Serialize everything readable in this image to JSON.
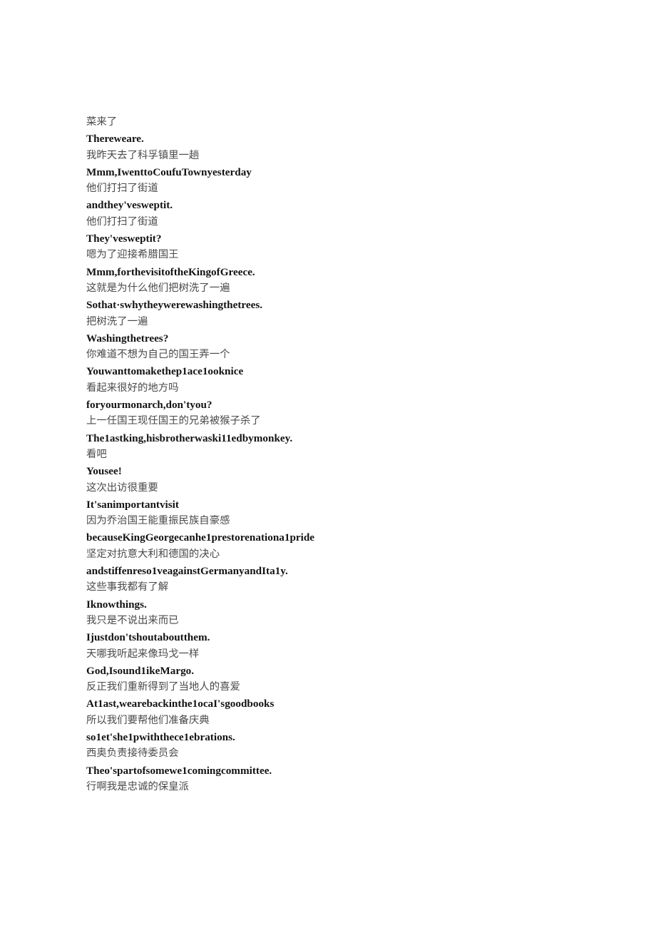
{
  "document": {
    "background_color": "#ffffff",
    "zh_text_color": "#4a4a4a",
    "en_text_color": "#131313",
    "lines": [
      {
        "lang": "zh",
        "text": "菜来了"
      },
      {
        "lang": "en",
        "text": "Thereweare."
      },
      {
        "lang": "zh",
        "text": "我昨天去了科孚镇里一趟"
      },
      {
        "lang": "en",
        "text": "Mmm,IwenttoCoufuTownyesterday"
      },
      {
        "lang": "zh",
        "text": "他们打扫了街道"
      },
      {
        "lang": "en",
        "text": "andthey'vesweptit."
      },
      {
        "lang": "zh",
        "text": "他们打扫了街道"
      },
      {
        "lang": "en",
        "text": "They'vesweptit?"
      },
      {
        "lang": "zh",
        "text": "嗯为了迎接希腊国王"
      },
      {
        "lang": "en",
        "text": "Mmm,forthevisitoftheKingofGreece."
      },
      {
        "lang": "zh",
        "text": "这就是为什么他们把树洗了一遍"
      },
      {
        "lang": "en",
        "text": "Sothat·swhytheywerewashingthetrees."
      },
      {
        "lang": "zh",
        "text": "把树洗了一遍"
      },
      {
        "lang": "en",
        "text": "Washingthetrees?"
      },
      {
        "lang": "zh",
        "text": "你难道不想为自己的国王弄一个"
      },
      {
        "lang": "en",
        "text": "Youwanttomakethep1ace1ooknice"
      },
      {
        "lang": "zh",
        "text": "看起来很好的地方吗"
      },
      {
        "lang": "en",
        "text": "foryourmonarch,don'tyou?"
      },
      {
        "lang": "zh",
        "text": "上一任国王现任国王的兄弟被猴子杀了"
      },
      {
        "lang": "en",
        "text": "The1astking,hisbrotherwaski11edbymonkey."
      },
      {
        "lang": "zh",
        "text": "看吧"
      },
      {
        "lang": "en",
        "text": "Yousee!"
      },
      {
        "lang": "zh",
        "text": "这次出访很重要"
      },
      {
        "lang": "en",
        "text": "It'sanimportantvisit"
      },
      {
        "lang": "zh",
        "text": "因为乔治国王能重振民族自豪感"
      },
      {
        "lang": "en",
        "text": "becauseKingGeorgecanhe1prestorenationa1pride"
      },
      {
        "lang": "zh",
        "text": "坚定对抗意大利和德国的决心"
      },
      {
        "lang": "en",
        "text": "andstiffenreso1veagainstGermanyandIta1y."
      },
      {
        "lang": "zh",
        "text": "这些事我都有了解"
      },
      {
        "lang": "en",
        "text": "Iknowthings."
      },
      {
        "lang": "zh",
        "text": "我只是不说出来而已"
      },
      {
        "lang": "en",
        "text": "Ijustdon'tshoutaboutthem."
      },
      {
        "lang": "zh",
        "text": "天哪我听起来像玛戈一样"
      },
      {
        "lang": "en",
        "text": "God,Isound1ikeMargo."
      },
      {
        "lang": "zh",
        "text": "反正我们重新得到了当地人的喜爱"
      },
      {
        "lang": "en",
        "text": "At1ast,wearebackinthe1ocaI'sgoodbooks"
      },
      {
        "lang": "zh",
        "text": "所以我们要帮他们准备庆典"
      },
      {
        "lang": "en",
        "text": "so1et'she1pwiththece1ebrations."
      },
      {
        "lang": "zh",
        "text": "西奥负责接待委员会"
      },
      {
        "lang": "en",
        "text": "Theo'spartofsomewe1comingcommittee."
      },
      {
        "lang": "zh",
        "text": "行啊我是忠诚的保皇派"
      }
    ]
  }
}
